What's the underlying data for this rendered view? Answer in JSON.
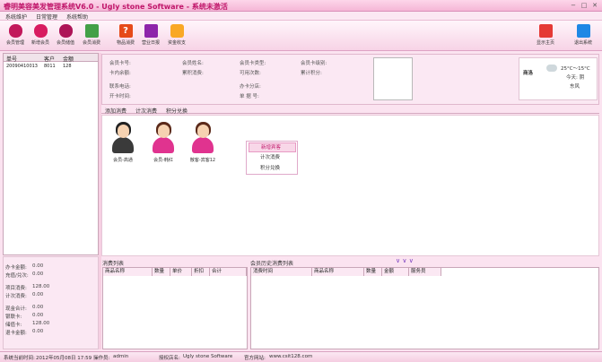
{
  "window": {
    "title": "睿明美容美发管理系统V6.0 - Ugly stone Software - 系统未激活"
  },
  "menu": [
    "系统维护",
    "日常管理",
    "系统帮助"
  ],
  "toolbar": {
    "items": [
      {
        "label": "会员管理",
        "icon": "member-icon",
        "color": "#c2185b"
      },
      {
        "label": "新增会员",
        "icon": "add-member-icon",
        "color": "#d81b60"
      },
      {
        "label": "会员储值",
        "icon": "deposit-icon",
        "color": "#ad1457"
      },
      {
        "label": "会员消费",
        "icon": "cart-icon",
        "color": "#43a047"
      },
      {
        "label": "物品消费",
        "icon": "help-icon",
        "color": "#e64a19"
      },
      {
        "label": "营业日报",
        "icon": "report-icon",
        "color": "#8e24aa"
      },
      {
        "label": "资金收支",
        "icon": "money-bag-icon",
        "color": "#f9a825"
      }
    ],
    "home_label": "显示主页",
    "exit_label": "退出系统"
  },
  "member_list": {
    "headers": [
      "单号",
      "客户",
      "金额"
    ],
    "rows": [
      [
        "20090410013",
        "8011",
        "128"
      ]
    ]
  },
  "member_info": {
    "card_no_label": "会员卡号:",
    "name_label": "会员姓名:",
    "card_type_label": "会员卡类型:",
    "level_label": "会员卡级别:",
    "balance_label": "卡内余额:",
    "consumed_label": "累积消费:",
    "times_label": "可用次数:",
    "points_label": "累计积分:",
    "phone_label": "联系电话:",
    "branch_label": "办卡分店:",
    "open_time_label": "开卡时间:",
    "order_no_label": "单 据 号:"
  },
  "weather": {
    "city": "商洛",
    "temp": "25°C～15°C",
    "today": "今天: 阴",
    "wind": "东风"
  },
  "tabs": [
    "添加消费",
    "计次消费",
    "积分兑换"
  ],
  "customers": [
    {
      "name": "会员-高通",
      "gender": "male"
    },
    {
      "name": "会员-韩红",
      "gender": "female"
    },
    {
      "name": "散客-宾客12",
      "gender": "female"
    }
  ],
  "context_menu": {
    "items": [
      "新增宾客",
      "计次消费",
      "积分兑换"
    ]
  },
  "summary": {
    "group1": [
      [
        "办卡金额:",
        "0.00"
      ],
      [
        "充值/兑次:",
        "0.00"
      ]
    ],
    "group2": [
      [
        "项目消费:",
        "128.00"
      ],
      [
        "计次消费:",
        "0.00"
      ]
    ],
    "group3": [
      [
        "现金合计:",
        "0.00"
      ],
      [
        "银联卡:",
        "0.00"
      ],
      [
        "储值卡:",
        "128.00"
      ],
      [
        "退卡金额:",
        "0.00"
      ]
    ]
  },
  "consume_list": {
    "title": "消费列表",
    "headers": [
      "商品名称",
      "数量",
      "单价",
      "折扣",
      "合计"
    ]
  },
  "history": {
    "title": "会员历史消费列表",
    "chevrons": "∨ ∨ ∨",
    "headers": [
      "消费时间",
      "商品名称",
      "数量",
      "金额",
      "服务员"
    ]
  },
  "status": {
    "time_label": "系统当前时间:",
    "time": "2012年05月08日 17:59",
    "operator_label": "操作员:",
    "operator": "admin",
    "licensee_label": "授权店名:",
    "licensee": "Ugly stone Software",
    "site_label": "官方网站:",
    "site": "www.csit128.com"
  }
}
